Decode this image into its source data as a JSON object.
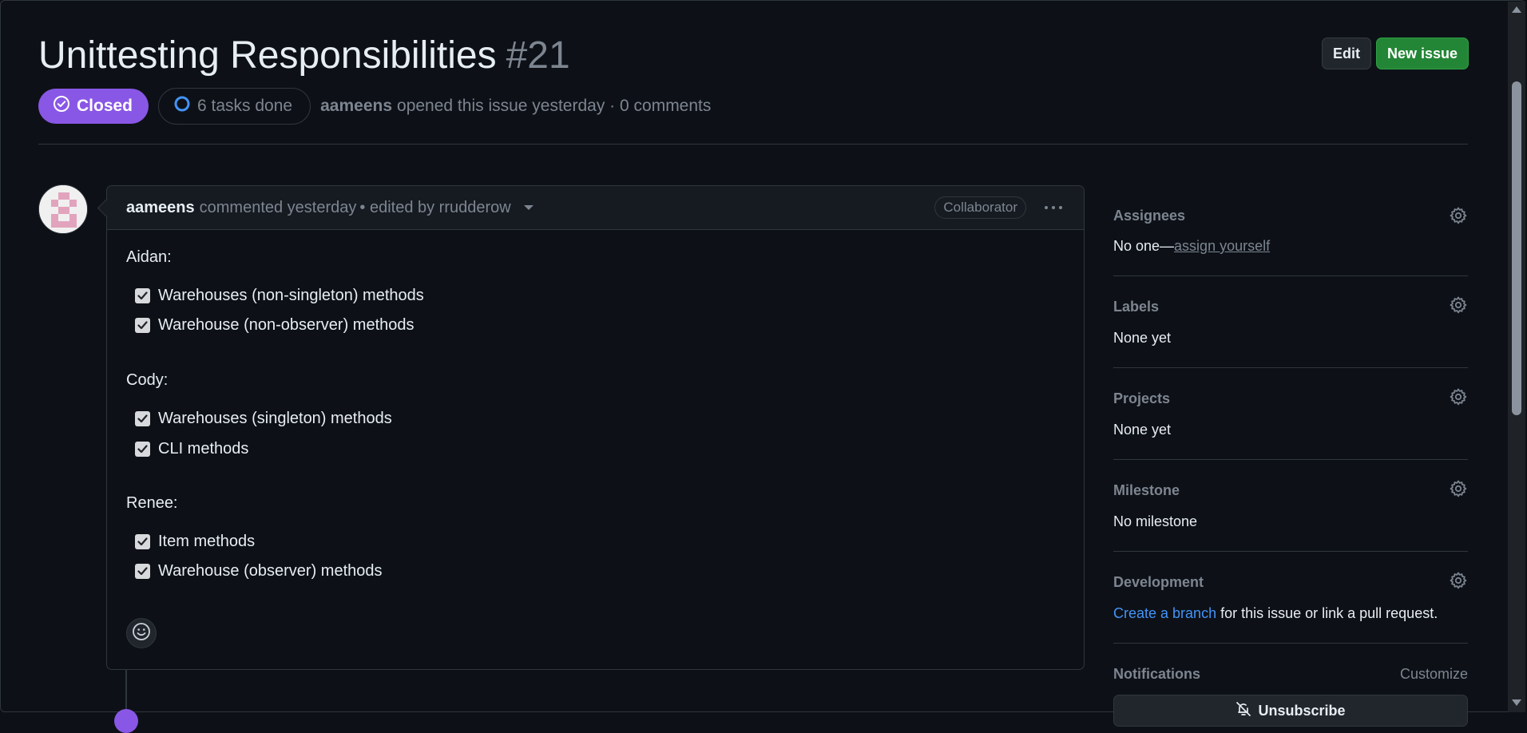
{
  "issue": {
    "title": "Unittesting Responsibilities",
    "number": "#21",
    "state": "Closed",
    "tasks": "6 tasks done",
    "opened_by": "aameens",
    "opened_text": "opened this issue yesterday · 0 comments"
  },
  "header_actions": {
    "edit": "Edit",
    "new_issue": "New issue"
  },
  "comment": {
    "author": "aameens",
    "meta": "commented yesterday",
    "edited": "• edited by rrudderow",
    "role": "Collaborator",
    "sections": [
      {
        "heading": "Aidan:",
        "tasks": [
          {
            "label": "Warehouses (non-singleton) methods",
            "checked": true
          },
          {
            "label": "Warehouse (non-observer) methods",
            "checked": true
          }
        ]
      },
      {
        "heading": "Cody:",
        "tasks": [
          {
            "label": "Warehouses (singleton) methods",
            "checked": true
          },
          {
            "label": "CLI methods",
            "checked": true
          }
        ]
      },
      {
        "heading": "Renee:",
        "tasks": [
          {
            "label": "Item methods",
            "checked": true
          },
          {
            "label": "Warehouse (observer) methods",
            "checked": true
          }
        ]
      }
    ]
  },
  "sidebar": {
    "assignees": {
      "title": "Assignees",
      "value": "No one—",
      "link": "assign yourself"
    },
    "labels": {
      "title": "Labels",
      "value": "None yet"
    },
    "projects": {
      "title": "Projects",
      "value": "None yet"
    },
    "milestone": {
      "title": "Milestone",
      "value": "No milestone"
    },
    "development": {
      "title": "Development",
      "link": "Create a branch",
      "value": " for this issue or link a pull request."
    },
    "notifications": {
      "title": "Notifications",
      "customize": "Customize",
      "button": "Unsubscribe"
    }
  },
  "colors": {
    "closed": "#8957e5",
    "new_issue": "#238636",
    "link": "#4493f8",
    "background": "#0d1117"
  }
}
